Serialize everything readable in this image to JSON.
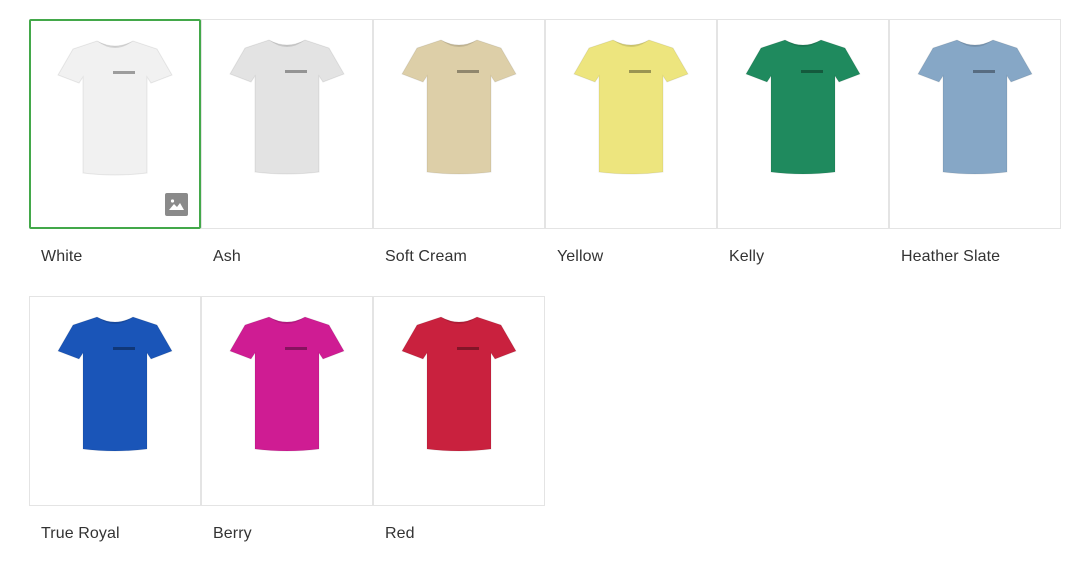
{
  "variants": [
    {
      "name": "White",
      "color": "#f1f1f1",
      "selected": true
    },
    {
      "name": "Ash",
      "color": "#e3e3e3",
      "selected": false
    },
    {
      "name": "Soft Cream",
      "color": "#ddcfa8",
      "selected": false
    },
    {
      "name": "Yellow",
      "color": "#ede57e",
      "selected": false
    },
    {
      "name": "Kelly",
      "color": "#1f8a5e",
      "selected": false
    },
    {
      "name": "Heather Slate",
      "color": "#86a7c6",
      "selected": false
    },
    {
      "name": "True Royal",
      "color": "#1a55b8",
      "selected": false
    },
    {
      "name": "Berry",
      "color": "#cf1c93",
      "selected": false
    },
    {
      "name": "Red",
      "color": "#c9213e",
      "selected": false
    }
  ],
  "selected_badge_icon": "image-icon"
}
